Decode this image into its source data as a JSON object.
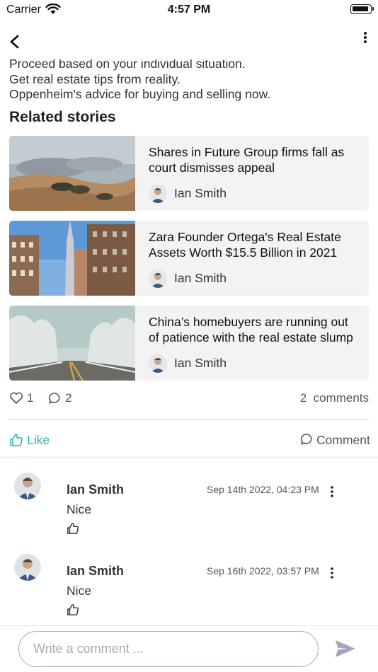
{
  "status_bar": {
    "carrier": "Carrier",
    "time": "4:57 PM"
  },
  "article": {
    "lines": [
      "Proceed based on your individual situation.",
      "Get real estate tips from reality.",
      "Oppenheim's advice for buying and selling now."
    ]
  },
  "related": {
    "title": "Related stories",
    "stories": [
      {
        "title": "Shares in Future Group firms fall as court dismisses appeal",
        "author": "Ian Smith"
      },
      {
        "title": "Zara Founder Ortega's Real Estate Assets Worth $15.5 Billion in 2021",
        "author": "Ian Smith"
      },
      {
        "title": "China’s homebuyers are running out of patience with the real estate slump",
        "author": "Ian Smith"
      }
    ]
  },
  "stats": {
    "likes": "1",
    "comments": "2",
    "comments_total": "2  comments"
  },
  "actions": {
    "like_label": "Like",
    "comment_label": "Comment"
  },
  "comments": [
    {
      "name": "Ian Smith",
      "date": "Sep 14th 2022, 04:23 PM",
      "text": "Nice"
    },
    {
      "name": "Ian Smith",
      "date": "Sep 16th 2022, 03:57 PM",
      "text": "Nice"
    }
  ],
  "composer": {
    "placeholder": "Write a comment ..."
  },
  "colors": {
    "accent": "#2bb6c0",
    "send": "#a7a3bf",
    "card_bg": "#f3f3f3"
  }
}
